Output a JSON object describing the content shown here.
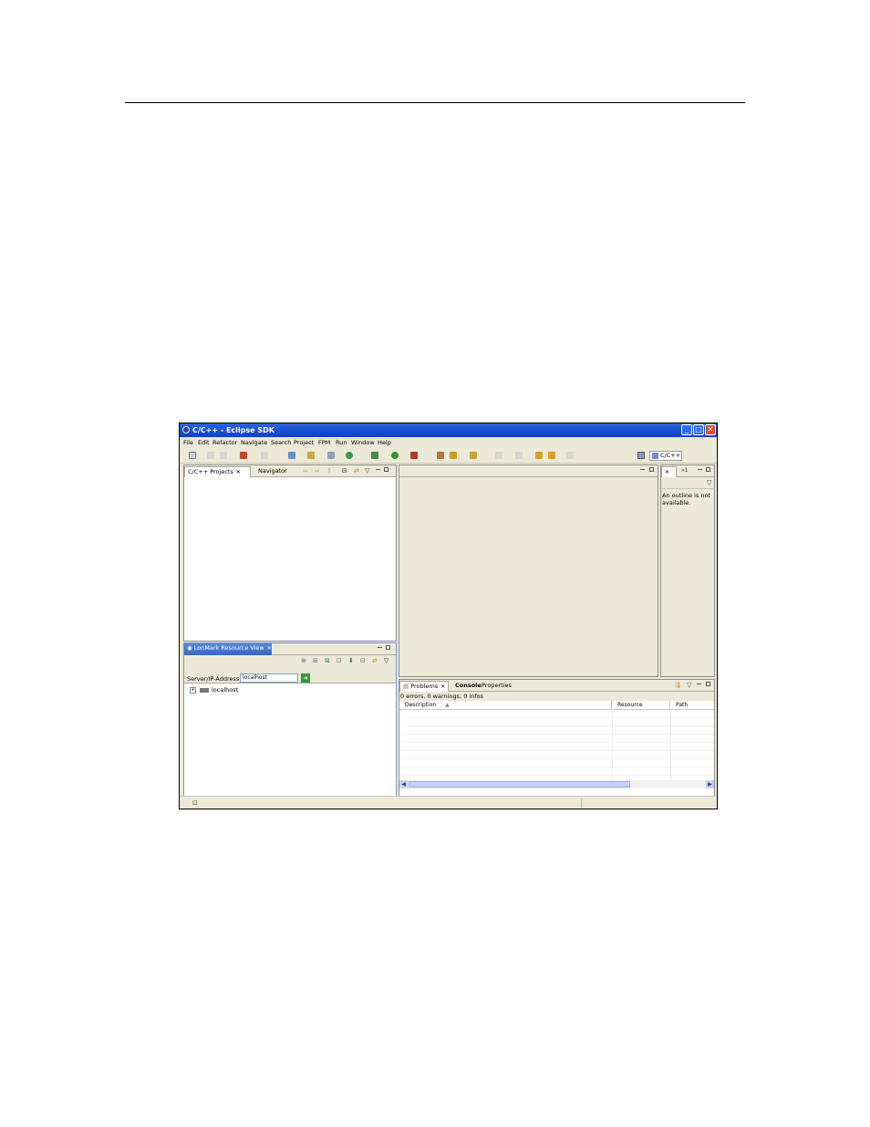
{
  "window": {
    "title": "C/C++ - Eclipse SDK"
  },
  "menu": [
    "File",
    "Edit",
    "Refactor",
    "Navigate",
    "Search",
    "Project",
    "FPM",
    "Run",
    "Window",
    "Help"
  ],
  "perspective": {
    "label": "C/C++"
  },
  "project_panel": {
    "tabs": [
      "C/C++ Projects",
      "Navigator"
    ]
  },
  "resource_view": {
    "title": "LonMark Resource View",
    "server_label": "Server/IP-Address:",
    "server_value": "localhost",
    "tree": [
      "localhost"
    ]
  },
  "outline": {
    "message": "An outline is not available."
  },
  "bottom_panel": {
    "tabs": [
      "Problems",
      "Console",
      "Properties"
    ],
    "summary": "0 errors, 0 warnings, 0 infos",
    "columns": [
      "Description",
      "Resource",
      "Path"
    ]
  },
  "colors": {
    "title_bar": "#0a3fc7",
    "chrome": "#ece9d8",
    "close_button": "#d9532c"
  }
}
